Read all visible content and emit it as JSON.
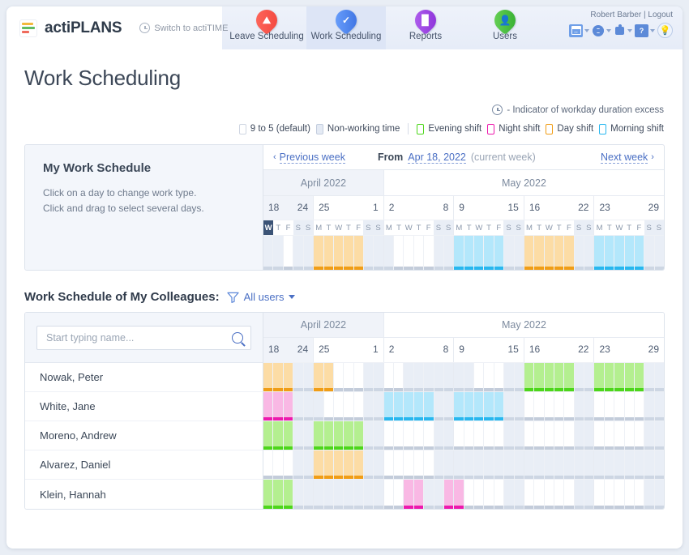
{
  "header": {
    "brand_name": "actiPLANS",
    "switch_label": "Switch to actiTIME",
    "nav": [
      {
        "label": "Leave Scheduling",
        "icon": "calendar-leaf-icon",
        "active": false
      },
      {
        "label": "Work Scheduling",
        "icon": "work-check-icon",
        "active": true
      },
      {
        "label": "Reports",
        "icon": "bar-chart-icon",
        "active": false
      },
      {
        "label": "Users",
        "icon": "user-icon",
        "active": false
      }
    ],
    "user_name": "Robert Barber",
    "logout_label": "Logout",
    "separator": "|",
    "tool_icons": [
      "calendar-settings-icon",
      "gear-icon",
      "puzzle-icon",
      "help-icon",
      "idea-bulb-icon"
    ]
  },
  "page": {
    "title": "Work Scheduling",
    "excess_note": "- Indicator of workday duration excess",
    "excess_icon": "clock-icon"
  },
  "legend": [
    {
      "label": "9 to 5 (default)",
      "color": "#ffffff",
      "border": "#cfd6e2"
    },
    {
      "label": "Non-working time",
      "color": "#e4eaf4",
      "border": "#c3cdde"
    },
    {
      "label": "Evening shift",
      "color": "#ffffff",
      "border": "#4cd61a"
    },
    {
      "label": "Night shift",
      "color": "#ffffff",
      "border": "#ed18ad"
    },
    {
      "label": "Day shift",
      "color": "#ffffff",
      "border": "#f09d16"
    },
    {
      "label": "Morning shift",
      "color": "#ffffff",
      "border": "#27b7ef"
    }
  ],
  "my_schedule": {
    "panel_title": "My Work Schedule",
    "hint_line1": "Click on a day to change work type.",
    "hint_line2": "Click and drag to select several days.",
    "nav": {
      "previous": "Previous week",
      "from_label": "From",
      "from_date": "Apr 18, 2022",
      "current_suffix": "(current week)",
      "next": "Next week",
      "prev_arrow": "‹",
      "next_arrow": "›"
    }
  },
  "calendar": {
    "months": [
      {
        "label": "April 2022",
        "weeks": 2,
        "lead": true
      },
      {
        "label": "May 2022",
        "weeks": 4,
        "lead": false
      }
    ],
    "weeks": [
      {
        "start": "18",
        "end": "24",
        "lead": true
      },
      {
        "start": "25",
        "end": "1",
        "lead": false
      },
      {
        "start": "2",
        "end": "8",
        "lead": false
      },
      {
        "start": "9",
        "end": "15",
        "lead": false
      },
      {
        "start": "16",
        "end": "22",
        "lead": false
      },
      {
        "start": "23",
        "end": "29",
        "lead": false
      }
    ],
    "day_letters": [
      "M",
      "T",
      "W",
      "T",
      "F",
      "S",
      "S"
    ],
    "today": {
      "week": 0,
      "day": 2
    }
  },
  "chart_data": {
    "type": "heatmap",
    "title": "Work Scheduling shift grid",
    "legend_position": "top-right",
    "categories": [
      "M",
      "T",
      "W",
      "T",
      "F",
      "S",
      "S"
    ],
    "week_starts": [
      "18",
      "25",
      "2",
      "9",
      "16",
      "23"
    ],
    "shift_types": {
      "default": "#ffffff",
      "nonworking": "#e9eef6",
      "morning": "#b3e7fb",
      "day": "#fcdca5",
      "evening": "#b4ef90",
      "night": "#f9b8e4"
    },
    "my_schedule_rows": [
      {
        "name": "My Work Schedule",
        "weeks": [
          [
            "nonworking",
            "nonworking",
            "nonworking",
            "nonworking",
            "default",
            "nonworking",
            "nonworking"
          ],
          [
            "day",
            "day",
            "day",
            "day",
            "day",
            "nonworking",
            "nonworking"
          ],
          [
            "nonworking",
            "default",
            "default",
            "default",
            "default",
            "nonworking",
            "nonworking"
          ],
          [
            "morning",
            "morning",
            "morning",
            "morning",
            "morning",
            "nonworking",
            "nonworking"
          ],
          [
            "day",
            "day",
            "day",
            "day",
            "day",
            "nonworking",
            "nonworking"
          ],
          [
            "morning",
            "morning",
            "morning",
            "morning",
            "morning",
            "nonworking",
            "nonworking"
          ]
        ]
      }
    ],
    "colleague_rows": [
      {
        "name": "Nowak, Peter",
        "weeks": [
          [
            "day",
            "day",
            "day",
            "day",
            "day",
            "nonworking",
            "nonworking"
          ],
          [
            "day",
            "day",
            "default",
            "default",
            "default",
            "nonworking",
            "nonworking"
          ],
          [
            "default",
            "default",
            "nonworking",
            "nonworking",
            "nonworking",
            "nonworking",
            "nonworking"
          ],
          [
            "nonworking",
            "nonworking",
            "default",
            "default",
            "default",
            "nonworking",
            "nonworking"
          ],
          [
            "evening",
            "evening",
            "evening",
            "evening",
            "evening",
            "nonworking",
            "nonworking"
          ],
          [
            "evening",
            "evening",
            "evening",
            "evening",
            "evening",
            "nonworking",
            "nonworking"
          ]
        ]
      },
      {
        "name": "White, Jane",
        "weeks": [
          [
            "night",
            "night",
            "night",
            "night",
            "night",
            "nonworking",
            "nonworking"
          ],
          [
            "nonworking",
            "default",
            "default",
            "default",
            "default",
            "nonworking",
            "nonworking"
          ],
          [
            "morning",
            "morning",
            "morning",
            "morning",
            "morning",
            "nonworking",
            "nonworking"
          ],
          [
            "morning",
            "morning",
            "morning",
            "morning",
            "morning",
            "nonworking",
            "nonworking"
          ],
          [
            "default",
            "default",
            "default",
            "default",
            "default",
            "nonworking",
            "nonworking"
          ],
          [
            "default",
            "default",
            "default",
            "default",
            "default",
            "nonworking",
            "nonworking"
          ]
        ]
      },
      {
        "name": "Moreno, Andrew",
        "weeks": [
          [
            "evening",
            "evening",
            "evening",
            "evening",
            "evening",
            "nonworking",
            "nonworking"
          ],
          [
            "evening",
            "evening",
            "evening",
            "evening",
            "evening",
            "nonworking",
            "nonworking"
          ],
          [
            "default",
            "default",
            "default",
            "default",
            "default",
            "nonworking",
            "nonworking"
          ],
          [
            "default",
            "default",
            "default",
            "default",
            "default",
            "nonworking",
            "nonworking"
          ],
          [
            "default",
            "default",
            "default",
            "default",
            "default",
            "nonworking",
            "nonworking"
          ],
          [
            "default",
            "default",
            "default",
            "default",
            "default",
            "nonworking",
            "nonworking"
          ]
        ]
      },
      {
        "name": "Alvarez, Daniel",
        "weeks": [
          [
            "nonworking",
            "nonworking",
            "default",
            "default",
            "default",
            "nonworking",
            "nonworking"
          ],
          [
            "day",
            "day",
            "day",
            "day",
            "day",
            "nonworking",
            "nonworking"
          ],
          [
            "default",
            "default",
            "default",
            "default",
            "default",
            "nonworking",
            "nonworking"
          ],
          [
            "nonworking",
            "nonworking",
            "nonworking",
            "nonworking",
            "nonworking",
            "nonworking",
            "nonworking"
          ],
          [
            "nonworking",
            "nonworking",
            "nonworking",
            "nonworking",
            "nonworking",
            "nonworking",
            "nonworking"
          ],
          [
            "nonworking",
            "nonworking",
            "nonworking",
            "nonworking",
            "nonworking",
            "nonworking",
            "nonworking"
          ]
        ]
      },
      {
        "name": "Klein, Hannah",
        "weeks": [
          [
            "evening",
            "evening",
            "evening",
            "evening",
            "evening",
            "nonworking",
            "nonworking"
          ],
          [
            "nonworking",
            "nonworking",
            "nonworking",
            "nonworking",
            "nonworking",
            "nonworking",
            "nonworking"
          ],
          [
            "default",
            "default",
            "night",
            "night",
            "nonworking",
            "nonworking",
            "night"
          ],
          [
            "night",
            "default",
            "default",
            "default",
            "default",
            "nonworking",
            "nonworking"
          ],
          [
            "default",
            "default",
            "default",
            "default",
            "default",
            "nonworking",
            "nonworking"
          ],
          [
            "default",
            "default",
            "default",
            "default",
            "default",
            "nonworking",
            "nonworking"
          ]
        ]
      }
    ]
  },
  "colleagues": {
    "title": "Work Schedule of My Colleagues:",
    "filter_label": "All users",
    "filter_icon": "funnel-icon",
    "search_placeholder": "Start typing name...",
    "search_value": "",
    "search_icon": "search-icon",
    "names": [
      "Nowak, Peter",
      "White, Jane",
      "Moreno, Andrew",
      "Alvarez, Daniel",
      "Klein, Hannah"
    ]
  }
}
